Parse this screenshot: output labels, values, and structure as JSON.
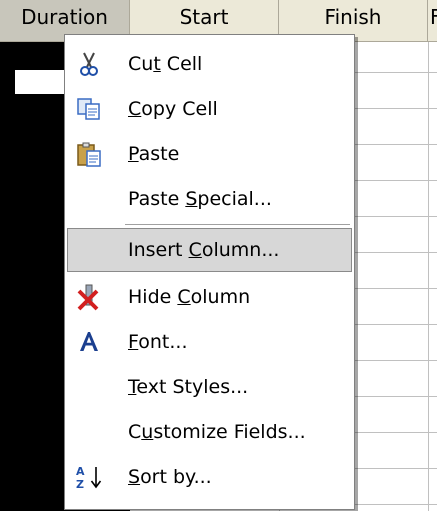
{
  "grid": {
    "columns": [
      {
        "label": "Duration",
        "selected": true
      },
      {
        "label": "Start",
        "selected": false
      },
      {
        "label": "Finish",
        "selected": false
      },
      {
        "label": "F",
        "selected": false
      }
    ]
  },
  "context_menu": {
    "items": [
      {
        "before": "Cu",
        "mnemonic": "t",
        "after": " Cell",
        "icon": "scissors-icon"
      },
      {
        "before": "",
        "mnemonic": "C",
        "after": "opy Cell",
        "icon": "copy-icon"
      },
      {
        "before": "",
        "mnemonic": "P",
        "after": "aste",
        "icon": "paste-icon"
      },
      {
        "before": "Paste ",
        "mnemonic": "S",
        "after": "pecial...",
        "icon": ""
      },
      {
        "before": "Insert ",
        "mnemonic": "C",
        "after": "olumn...",
        "icon": "",
        "highlighted": true
      },
      {
        "before": "Hide ",
        "mnemonic": "C",
        "after": "olumn",
        "icon": "hide-column-icon"
      },
      {
        "before": "",
        "mnemonic": "F",
        "after": "ont...",
        "icon": "font-icon"
      },
      {
        "before": "",
        "mnemonic": "T",
        "after": "ext Styles...",
        "icon": ""
      },
      {
        "before": "C",
        "mnemonic": "u",
        "after": "stomize Fields...",
        "icon": ""
      },
      {
        "before": "",
        "mnemonic": "S",
        "after": "ort by...",
        "icon": "sort-icon"
      }
    ]
  },
  "colors": {
    "header_bg": "#ece9d8",
    "selected_header_bg": "#c8c6bb",
    "highlight_bg": "#d7d7d7",
    "menu_border": "#808080",
    "selected_column": "#000000"
  }
}
